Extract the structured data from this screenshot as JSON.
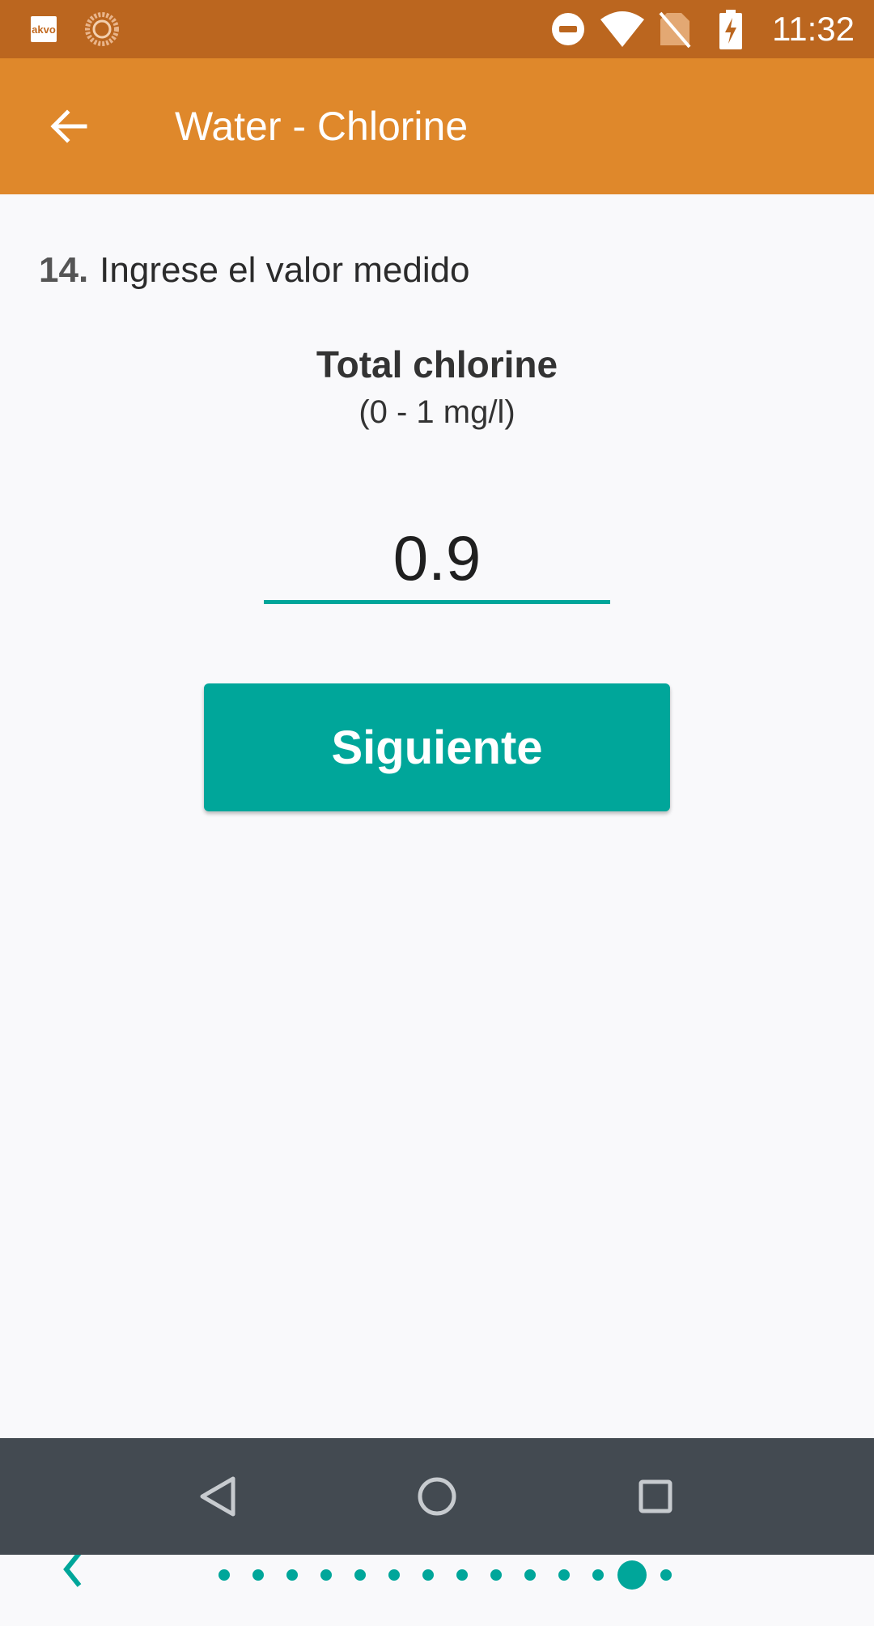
{
  "status_bar": {
    "app_badge_text": "akvo",
    "time": "11:32",
    "icons": [
      "akvo-icon",
      "sync-icon",
      "dnd-icon",
      "wifi-icon",
      "no-sim-icon",
      "battery-charging-icon"
    ]
  },
  "app_bar": {
    "back_icon": "arrow-back-icon",
    "title": "Water - Chlorine"
  },
  "question": {
    "number": "14.",
    "text": "Ingrese el valor medido"
  },
  "field": {
    "label": "Total chlorine",
    "range": "(0 - 1 mg/l)",
    "value": "0.9"
  },
  "next_button": {
    "label": "Siguiente"
  },
  "pager": {
    "prev_icon": "chevron-left-icon",
    "total_pages": 14,
    "current_page": 13
  },
  "nav_bar": {
    "icons": [
      "back-triangle-icon",
      "home-circle-icon",
      "recents-square-icon"
    ]
  },
  "colors": {
    "status_bar": "#bb661f",
    "app_bar": "#df882b",
    "accent": "#00a69a",
    "nav_bar": "#434a51"
  }
}
